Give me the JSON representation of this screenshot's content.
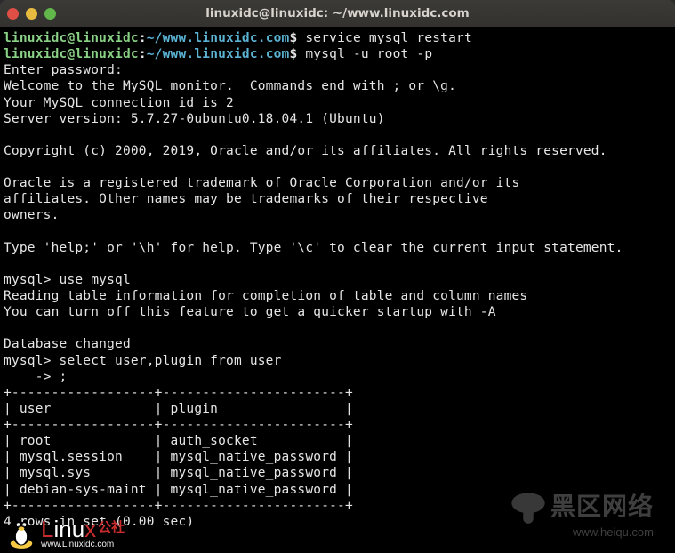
{
  "window": {
    "title": "linuxidc@linuxidc: ~/www.linuxidc.com"
  },
  "prompt": {
    "user_host": "linuxidc@linuxidc",
    "sep1": ":",
    "cwd": "~/www.linuxidc.com",
    "sigil": "$"
  },
  "cmds": {
    "c1": "service mysql restart",
    "c2": "mysql -u root -p"
  },
  "out": {
    "l01": "Enter password:",
    "l02": "Welcome to the MySQL monitor.  Commands end with ; or \\g.",
    "l03": "Your MySQL connection id is 2",
    "l04": "Server version: 5.7.27-0ubuntu0.18.04.1 (Ubuntu)",
    "l05": "",
    "l06": "Copyright (c) 2000, 2019, Oracle and/or its affiliates. All rights reserved.",
    "l07": "",
    "l08": "Oracle is a registered trademark of Oracle Corporation and/or its",
    "l09": "affiliates. Other names may be trademarks of their respective",
    "l10": "owners.",
    "l11": "",
    "l12": "Type 'help;' or '\\h' for help. Type '\\c' to clear the current input statement.",
    "l13": "",
    "l14": "mysql> use mysql",
    "l15": "Reading table information for completion of table and column names",
    "l16": "You can turn off this feature to get a quicker startup with -A",
    "l17": "",
    "l18": "Database changed",
    "l19": "mysql> select user,plugin from user",
    "l20": "    -> ;",
    "t_border": "+------------------+-----------------------+",
    "t_head": "| user             | plugin                |",
    "t_r1": "| root             | auth_socket           |",
    "t_r2": "| mysql.session    | mysql_native_password |",
    "t_r3": "| mysql.sys        | mysql_native_password |",
    "t_r4": "| debian-sys-maint | mysql_native_password |",
    "summary": "4 rows in set (0.00 sec)"
  },
  "watermark": {
    "brand": "黑区网络",
    "host": "www.heiqu.com"
  },
  "badge": {
    "word_red1": "L",
    "word_wht": "inu",
    "word_red2": "x",
    "cn": "公社",
    "url": "www.Linuxidc.com"
  }
}
